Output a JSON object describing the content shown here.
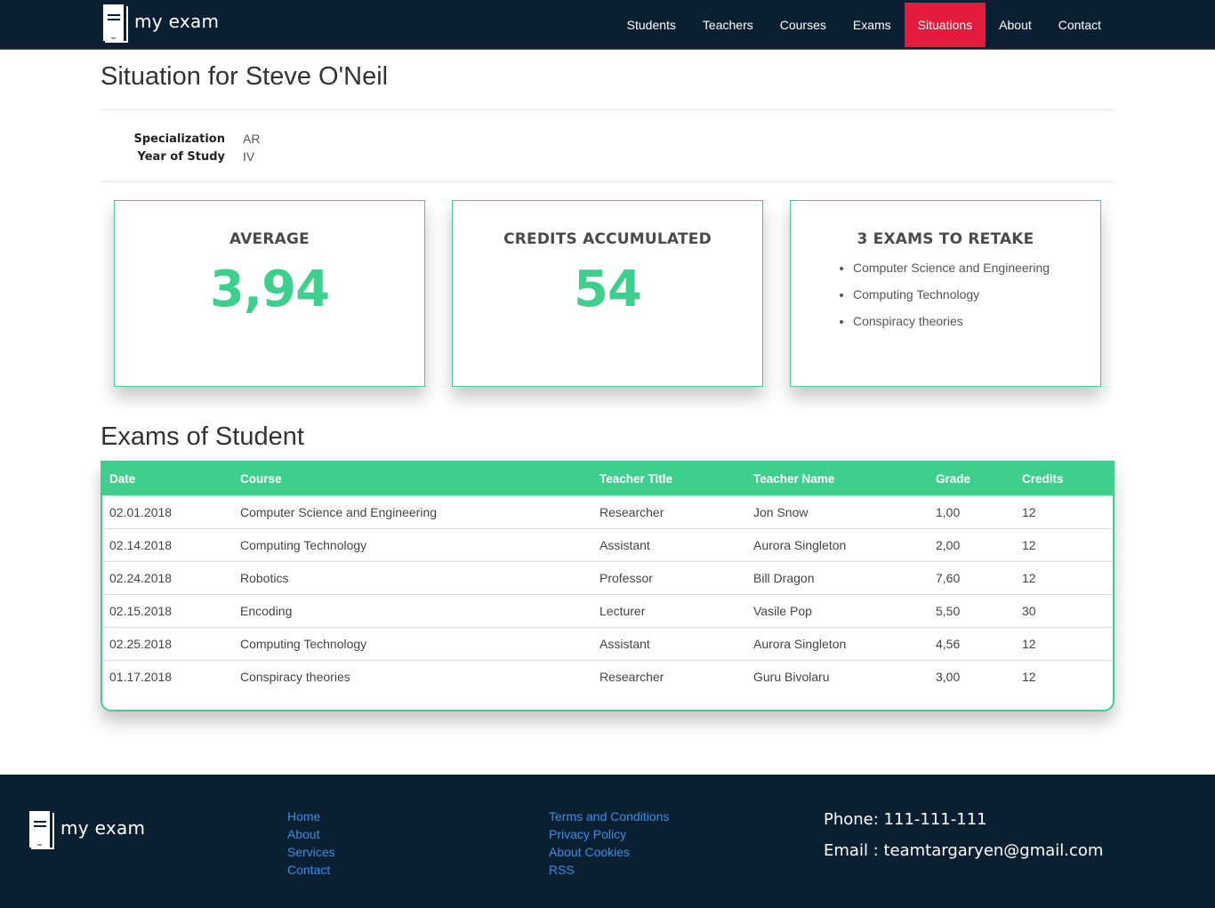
{
  "brand": {
    "name": "my exam"
  },
  "nav": [
    {
      "label": "Students"
    },
    {
      "label": "Teachers"
    },
    {
      "label": "Courses"
    },
    {
      "label": "Exams"
    },
    {
      "label": "Situations",
      "active": true
    },
    {
      "label": "About"
    },
    {
      "label": "Contact"
    }
  ],
  "page": {
    "title": "Situation for Steve O'Neil",
    "specialization_label": "Specialization",
    "specialization_value": "AR",
    "year_label": "Year of Study",
    "year_value": "IV"
  },
  "cards": {
    "average": {
      "title": "AVERAGE",
      "value": "3,94"
    },
    "credits": {
      "title": "CREDITS ACCUMULATED",
      "value": "54"
    },
    "retake": {
      "title": "3 EXAMS TO RETAKE",
      "items": [
        "Computer Science and Engineering",
        "Computing Technology",
        "Conspiracy theories"
      ]
    }
  },
  "exams": {
    "title": "Exams of Student",
    "columns": [
      "Date",
      "Course",
      "Teacher Title",
      "Teacher Name",
      "Grade",
      "Credits"
    ],
    "rows": [
      [
        "02.01.2018",
        "Computer Science and Engineering",
        "Researcher",
        "Jon Snow",
        "1,00",
        "12"
      ],
      [
        "02.14.2018",
        "Computing Technology",
        "Assistant",
        "Aurora Singleton",
        "2,00",
        "12"
      ],
      [
        "02.24.2018",
        "Robotics",
        "Professor",
        "Bill Dragon",
        "7,60",
        "12"
      ],
      [
        "02.15.2018",
        "Encoding",
        "Lecturer",
        "Vasile Pop",
        "5,50",
        "30"
      ],
      [
        "02.25.2018",
        "Computing Technology",
        "Assistant",
        "Aurora Singleton",
        "4,56",
        "12"
      ],
      [
        "01.17.2018",
        "Conspiracy theories",
        "Researcher",
        "Guru Bivolaru",
        "3,00",
        "12"
      ]
    ]
  },
  "footer": {
    "links1": [
      "Home",
      "About",
      "Services",
      "Contact"
    ],
    "links2": [
      "Terms and Conditions",
      "Privacy Policy",
      "About Cookies",
      "RSS"
    ],
    "phone": "Phone: 111-111-111",
    "email": "Email : teamtargaryen@gmail.com"
  },
  "colors": {
    "navy": "#0b1f33",
    "accent_red": "#e31c3d",
    "accent_green": "#3ecf8e",
    "link_blue": "#3a8fe0"
  },
  "icons": {
    "logo": "book-icon"
  }
}
